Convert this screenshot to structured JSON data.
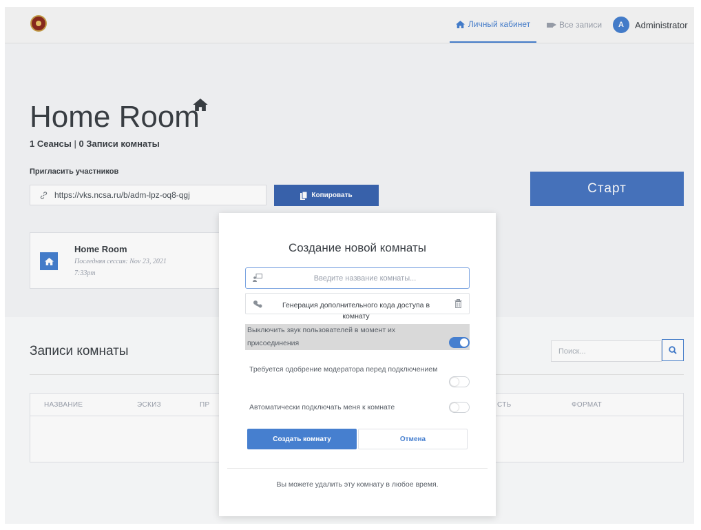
{
  "nav": {
    "home_label": "Личный кабинет",
    "recordings_label": "Все записи",
    "user_initial": "A",
    "user_name": "Administrator"
  },
  "room": {
    "title": "Home Room",
    "sessions": "1 Сеансы",
    "separator": "|",
    "recordings_count": "0 Записи комнаты",
    "invite_label": "Пригласить участников",
    "invite_url": "https://vks.ncsa.ru/b/adm-lpz-oq8-qgj",
    "copy_label": "Копировать",
    "start_label": "Старт"
  },
  "room_card": {
    "name": "Home Room",
    "last_session": "Последняя сессия: Nov 23, 2021 7:33pm"
  },
  "recordings": {
    "title": "Записи комнаты",
    "search_placeholder": "Поиск...",
    "columns": [
      "НАЗВАНИЕ",
      "ЭСКИЗ",
      "ПР",
      "СТЬ",
      "ФОРМАТ"
    ]
  },
  "modal": {
    "title": "Создание новой комнаты",
    "name_placeholder": "Введите название комнаты...",
    "access_code_label": "Генерация дополнительного кода доступа в комнату",
    "mute_label": "Выключить звук пользователей в момент их присоединения",
    "mute_on": true,
    "approval_label": "Требуется одобрение модератора перед подключением",
    "approval_on": false,
    "autojoin_label": "Автоматически подключать меня к комнате",
    "autojoin_on": false,
    "create_label": "Создать комнату",
    "cancel_label": "Отмена",
    "footer": "Вы можете удалить эту комнату в любое время."
  },
  "colors": {
    "accent": "#467fcf",
    "start_button": "#4875c0",
    "copy_button": "#3a65b0"
  }
}
